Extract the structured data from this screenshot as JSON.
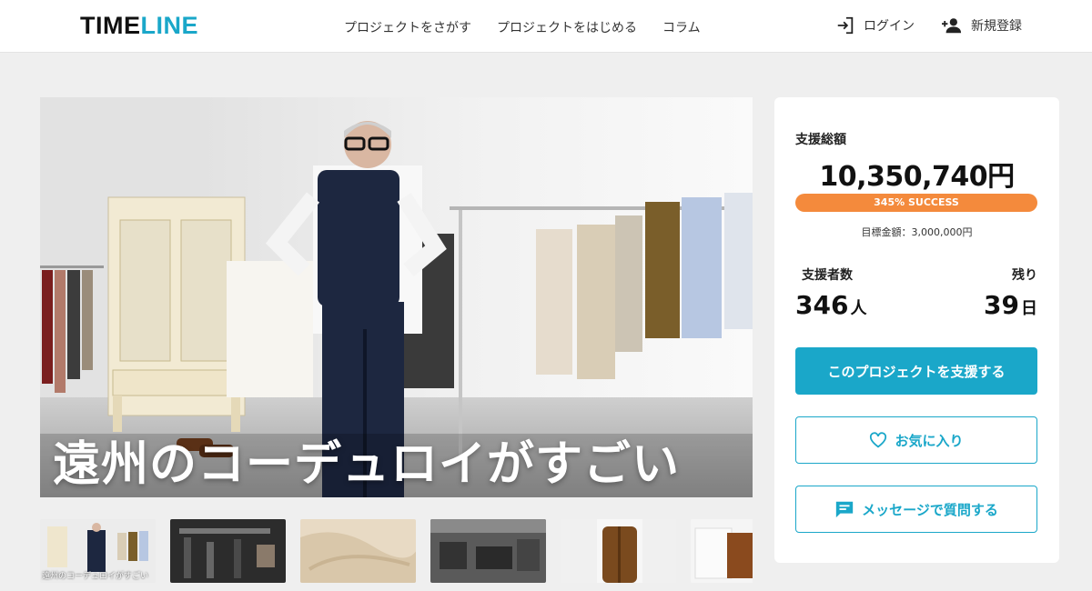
{
  "header": {
    "logo_a": "TIME",
    "logo_b": "LINE",
    "nav": [
      "プロジェクトをさがす",
      "プロジェクトをはじめる",
      "コラム"
    ],
    "login": "ログイン",
    "signup": "新規登録"
  },
  "hero": {
    "title": "遠州のコーデュロイがすごい"
  },
  "thumbnails": {
    "first_caption": "遠州のコーデュロイがすごい"
  },
  "funding": {
    "total_label": "支援総額",
    "total": "10,350,740円",
    "progress_text": "345% SUCCESS",
    "progress_percent": 345,
    "goal": "目標金額：3,000,000円",
    "backers_label": "支援者数",
    "backers_value": "346",
    "backers_unit": "人",
    "remaining_label": "残り",
    "remaining_value": "39",
    "remaining_unit": "日"
  },
  "actions": {
    "support": "このプロジェクトを支援する",
    "favorite": "お気に入り",
    "message": "メッセージで質問する"
  },
  "colors": {
    "accent": "#1aa7c9",
    "progress": "#f48a3c"
  }
}
